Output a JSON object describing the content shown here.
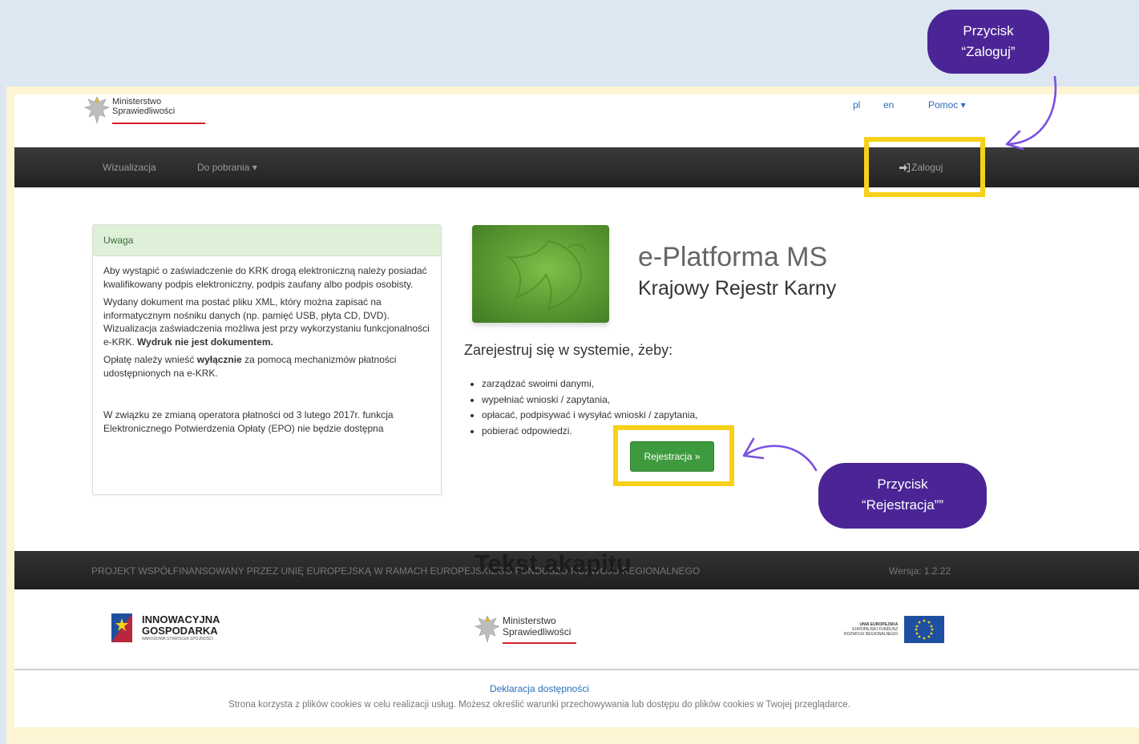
{
  "header": {
    "logo_line1": "Ministerstwo",
    "logo_line2": "Sprawiedliwości",
    "lang_pl": "pl",
    "lang_en": "en",
    "help": "Pomoc ▾"
  },
  "navbar": {
    "item1": "Wizualizacja",
    "item2": "Do pobrania ▾",
    "login": "Zaloguj"
  },
  "alert": {
    "title": "Uwaga",
    "p1": "Aby wystąpić o zaświadczenie do KRK drogą elektroniczną należy posiadać kwalifikowany podpis elektroniczny, podpis zaufany albo podpis osobisty.",
    "p2": "Wydany dokument ma postać pliku XML, który można zapisać na informatycznym nośniku danych (np. pamięć USB, płyta CD, DVD). Wizualizacja zaświadczenia możliwa jest przy wykorzystaniu funkcjonalności e-KRK.",
    "p2_bold": "Wydruk nie jest dokumentem.",
    "p3_pre": "Opłatę należy wnieść",
    "p3_bold": "wyłącznie",
    "p3_post": "za pomocą mechanizmów płatności udostępnionych na e-KRK.",
    "p4": "W związku ze zmianą operatora płatności od 3 lutego 2017r. funkcja Elektronicznego Potwierdzenia Opłaty (EPO) nie będzie dostępna"
  },
  "hero": {
    "title": "e-Platforma MS",
    "subtitle": "Krajowy Rejestr Karny",
    "register_heading": "Zarejestruj się w systemie, żeby:",
    "bullets": [
      "zarządzać swoimi danymi,",
      "wypełniać wnioski / zapytania,",
      "opłacać, podpisywać i wysyłać wnioski / zapytania,",
      "pobierać odpowiedzi."
    ],
    "register_button": "Rejestracja »"
  },
  "footer": {
    "project_text": "PROJEKT WSPÓŁFINANSOWANY PRZEZ UNIĘ EUROPEJSKĄ W RAMACH EUROPEJSKIEGO FUNDUSZU ROZWOJU REGIONALNEGO",
    "version": "Wersja: 1.2.22",
    "ig_line1": "INNOWACYJNA",
    "ig_line2": "GOSPODARKA",
    "ig_line3": "NARODOWA STRATEGIA SPÓJNOŚCI",
    "ms_line1": "Ministerstwo",
    "ms_line2": "Sprawiedliwości",
    "eu_line1": "UNIA EUROPEJSKA",
    "eu_line2": "EUROPEJSKI FUNDUSZ",
    "eu_line3": "ROZWOJU REGIONALNEGO",
    "declaration": "Deklaracja dostępności",
    "cookies": "Strona korzysta z plików cookies w celu realizacji usług. Możesz określić warunki przechowywania lub dostępu do plików cookies w Twojej przeglądarce."
  },
  "overlay_text": "Tekst akapitu",
  "annotations": {
    "login_line1": "Przycisk",
    "login_line2": "“Zaloguj”",
    "register_line1": "Przycisk",
    "register_line2": "“Rejestracja””"
  },
  "colors": {
    "highlight": "#f7d117",
    "bubble": "#4b2596",
    "arrow": "#7b4fe0"
  }
}
